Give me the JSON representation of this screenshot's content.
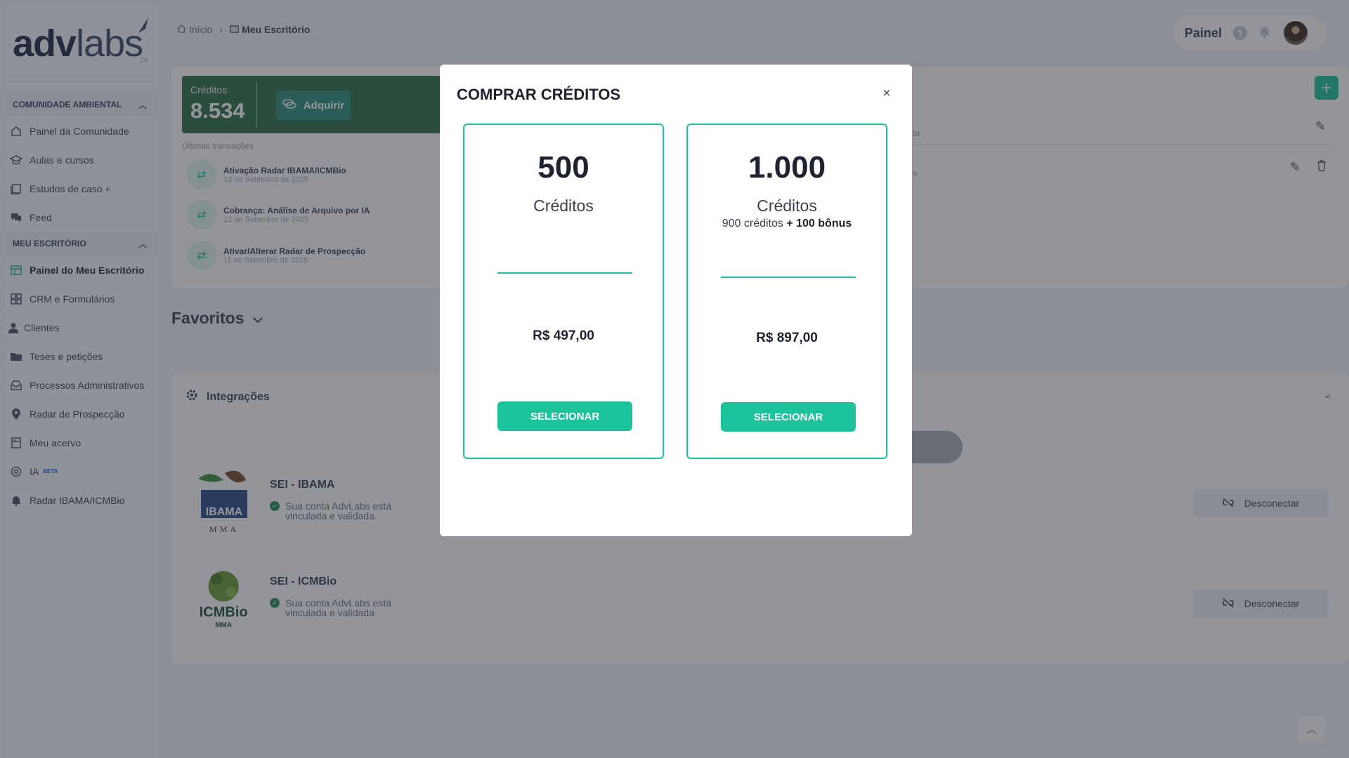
{
  "logo": {
    "bold": "adv",
    "light": "labs",
    "version": "2.0"
  },
  "sidebar": {
    "sections": [
      {
        "title": "COMUNIDADE AMBIENTAL",
        "items": [
          {
            "label": "Painel da Comunidade",
            "icon": "community-icon"
          },
          {
            "label": "Aulas e cursos",
            "icon": "graduation-icon"
          },
          {
            "label": "Estudos de caso +",
            "icon": "book-icon"
          },
          {
            "label": "Feed",
            "icon": "chat-icon"
          }
        ]
      },
      {
        "title": "MEU ESCRITÓRIO",
        "items": [
          {
            "label": "Painel do Meu Escritório",
            "icon": "dashboard-icon",
            "active": true
          },
          {
            "label": "CRM e Formulários",
            "icon": "grid-icon"
          },
          {
            "label": "Clientes",
            "icon": "user-icon"
          },
          {
            "label": "Teses e petições",
            "icon": "folder-icon"
          },
          {
            "label": "Processos Administrativos",
            "icon": "inbox-icon"
          },
          {
            "label": "Radar de Prospecção",
            "icon": "location-pin-icon"
          },
          {
            "label": "Meu acervo",
            "icon": "archive-icon"
          },
          {
            "label": "IA",
            "badge": "BETA",
            "icon": "ai-icon"
          },
          {
            "label": "Radar IBAMA/ICMBio",
            "icon": "bell-icon"
          }
        ]
      }
    ]
  },
  "breadcrumb": {
    "home": "Início",
    "current": "Meu Escritório"
  },
  "topbar": {
    "label": "Painel"
  },
  "credits": {
    "label": "Créditos",
    "value": "8.534",
    "acquire_label": "Adquirir",
    "transactions_title": "Últimas transações",
    "transactions": [
      {
        "title": "Ativação Radar IBAMA/ICMBio",
        "date": "13 de Setembro de 2025"
      },
      {
        "title": "Cobrança: Análise de Arquivo por IA",
        "date": "12 de Setembro de 2025"
      },
      {
        "title": "Ativar/Alterar Radar de Prospecção",
        "date": "11 de Setembro de 2025"
      }
    ],
    "row_fragments": [
      ".br",
      "m"
    ]
  },
  "favorites": {
    "title": "Favoritos"
  },
  "integrations": {
    "title": "Integrações",
    "items": [
      {
        "name": "SEI - IBAMA",
        "status": "Sua conta AdvLabs está vinculada e validada",
        "logo_text": "IBAMA",
        "logo_sub": "MMA",
        "action": "Desconectar"
      },
      {
        "name": "SEI - ICMBio",
        "status": "Sua conta AdvLabs está vinculada e validada",
        "logo_text": "ICMBio",
        "logo_sub": "MMA",
        "action": "Desconectar"
      }
    ]
  },
  "modal": {
    "title": "COMPRAR CRÉDITOS",
    "plans": [
      {
        "amount": "500",
        "unit": "Créditos",
        "bonus_base": "",
        "bonus_extra": "",
        "price": "R$ 497,00",
        "button": "SELECIONAR"
      },
      {
        "amount": "1.000",
        "unit": "Créditos",
        "bonus_base": "900 créditos",
        "bonus_extra": "+ 100 bônus",
        "price": "R$ 897,00",
        "button": "SELECIONAR"
      }
    ]
  },
  "colors": {
    "accent": "#1cc29a",
    "credits_green": "#2f6e46",
    "overlay": "#282c36"
  }
}
